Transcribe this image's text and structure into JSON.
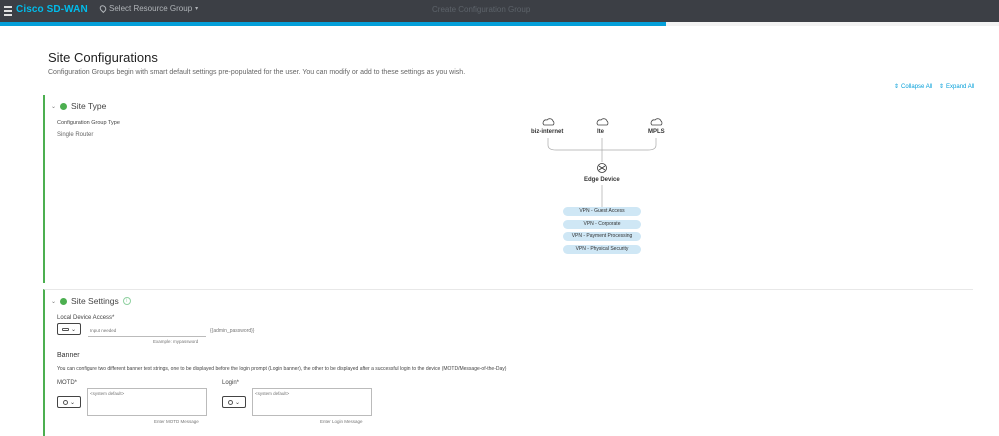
{
  "topbar": {
    "brand": "Cisco SD-WAN",
    "resource_group": "Select Resource Group",
    "title": "Create Configuration Group",
    "progress_percent": 66.7
  },
  "header": {
    "title": "Site Configurations",
    "subtitle": "Configuration Groups begin with smart default settings pre-populated for the user. You can modify or add to these settings as you wish.",
    "collapse_all": "Collapse All",
    "expand_all": "Expand All"
  },
  "site_type": {
    "title": "Site Type",
    "group_type_label": "Configuration Group Type",
    "group_type_value": "Single Router",
    "diagram": {
      "clouds": [
        "biz-internet",
        "lte",
        "MPLS"
      ],
      "device": "Edge Device",
      "vpns": [
        "VPN - Guest Access",
        "VPN - Corporate",
        "VPN - Payment Processing",
        "VPN - Physical Security"
      ]
    }
  },
  "site_settings": {
    "title": "Site Settings",
    "info": "i",
    "local_access_label": "Local Device Access*",
    "password_placeholder": "Input needed",
    "password_example": "Example: mypassword",
    "password_variable": "{{admin_password}}",
    "banner_title": "Banner",
    "banner_desc": "You can configure two different banner text strings, one to be displayed before the login prompt (Login banner), the other to be displayed after a successful login to the device (MOTD/Message-of-the-Day)",
    "motd_label": "MOTD*",
    "motd_placeholder": "<system default>",
    "motd_helper": "Enter MOTD Message",
    "login_label": "Login*",
    "login_placeholder": "<system default>",
    "login_helper": "Enter Login Message"
  },
  "colors": {
    "accent": "#049fd9",
    "success": "#4caf50",
    "topbar": "#3c3f45"
  }
}
